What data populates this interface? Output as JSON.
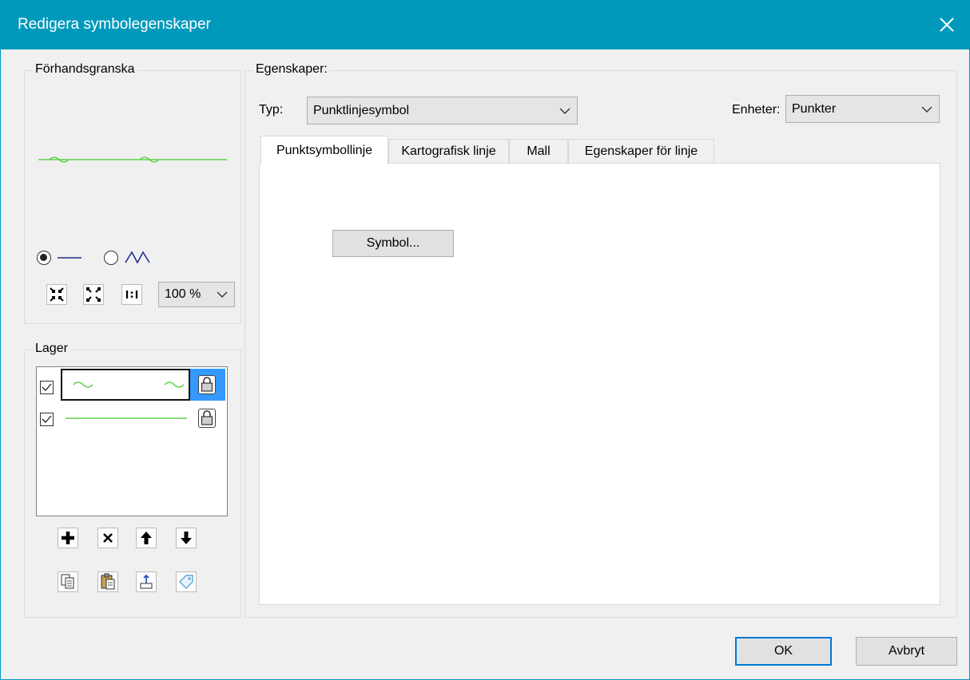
{
  "window": {
    "title": "Redigera symbolegenskaper"
  },
  "preview": {
    "legend": "Förhandsgranska",
    "zoom_value": "100 %"
  },
  "layers": {
    "legend": "Lager"
  },
  "properties": {
    "legend": "Egenskaper:",
    "type_label": "Typ:",
    "type_value": "Punktlinjesymbol",
    "units_label": "Enheter:",
    "units_value": "Punkter",
    "tabs": [
      "Punktsymbollinje",
      "Kartografisk linje",
      "Mall",
      "Egenskaper för linje"
    ],
    "symbol_button": "Symbol..."
  },
  "footer": {
    "ok": "OK",
    "cancel": "Avbryt"
  },
  "colors": {
    "titlebar": "#0099bc",
    "line_green": "#5ed04a",
    "selection_blue": "#3399ff"
  }
}
